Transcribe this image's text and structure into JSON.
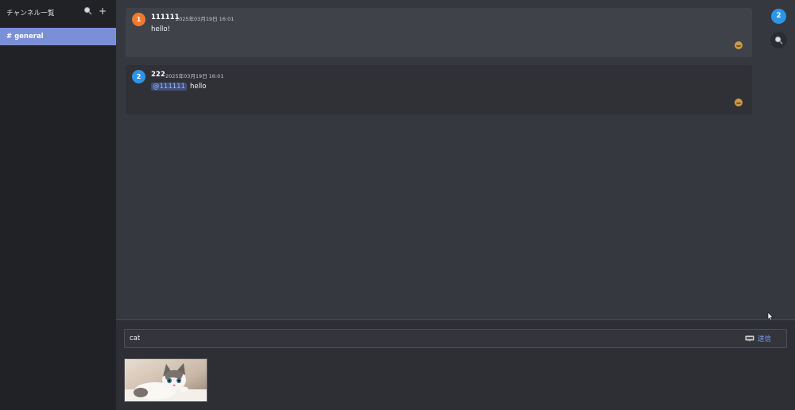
{
  "sidebar": {
    "title": "チャンネル一覧",
    "icons": [
      "search-icon",
      "plus-icon"
    ],
    "add_label": "+",
    "channels": [
      {
        "label": "# general",
        "active": true
      }
    ]
  },
  "messages": [
    {
      "avatar": "1",
      "avatar_color": "#ee7a32",
      "author": "111111",
      "time": "2025年03月19日 16:01",
      "mention": "",
      "text": "hello!",
      "reaction_icon": "emoji-icon"
    },
    {
      "avatar": "2",
      "avatar_color": "#2b95e9",
      "author": "222",
      "time": "2025年03月19日 16:01",
      "mention": "@111111",
      "text": "hello",
      "reaction_icon": "emoji-icon"
    }
  ],
  "rail": {
    "avatar": "2",
    "avatar_color": "#2b95e9",
    "search_icon": "search-icon"
  },
  "composer": {
    "input_value": "cat",
    "send_label": "送信",
    "gif_icon": "gif-icon",
    "preview_alt": "cat"
  },
  "colors": {
    "accent": "#7b8fd9",
    "link": "#7da2f0"
  }
}
